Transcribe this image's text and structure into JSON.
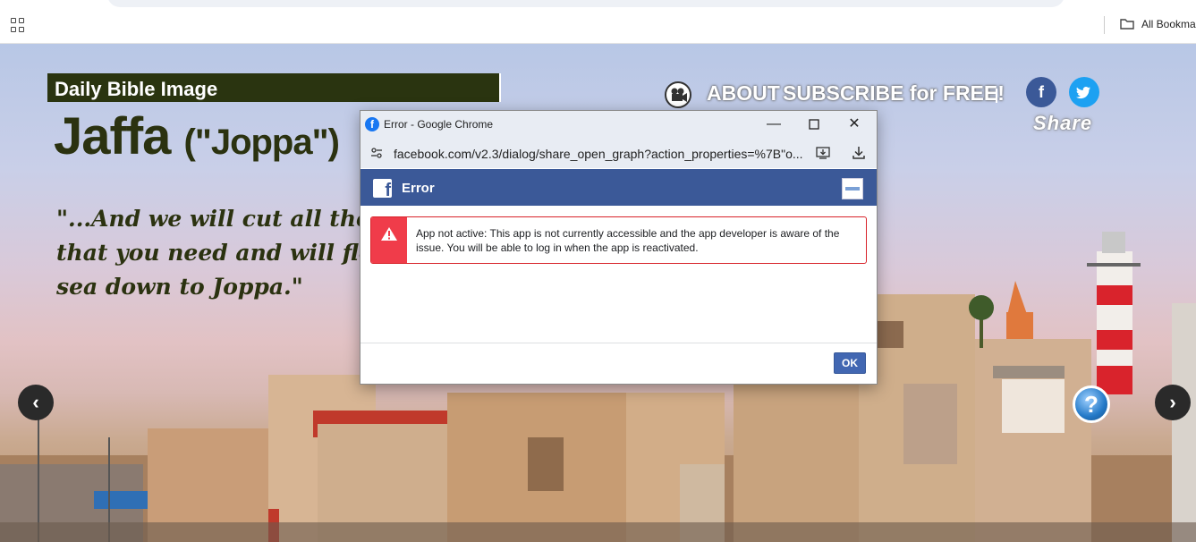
{
  "browser": {
    "bookmarks_label": "All Bookma"
  },
  "site": {
    "banner": "Daily Bible Image",
    "title_main": "Jaffa",
    "title_sub": "(\"Joppa\")",
    "quote_lines": [
      "\"...And we will cut all the logs j",
      "that you need and will float the",
      "sea down to Joppa.\""
    ],
    "nav": {
      "about": "ABOUT",
      "subscribe": "SUBSCRIBE for FREE!"
    },
    "share_label": "Share",
    "icons": {
      "prev": "chevron-left-icon",
      "next": "chevron-right-icon",
      "help": "question-mark-icon",
      "video": "video-camera-icon"
    }
  },
  "popup": {
    "window_title": "Error - Google Chrome",
    "url": "facebook.com/v2.3/dialog/share_open_graph?action_properties=%7B\"o...",
    "header_title": "Error",
    "error_message": "App not active: This app is not currently accessible and the app developer is aware of the issue. You will be able to log in when the app is reactivated.",
    "ok_label": "OK"
  },
  "colors": {
    "facebook_blue": "#3b5998",
    "error_red": "#f03c4a",
    "banner_green": "#2a3410",
    "ok_button": "#4267b2"
  }
}
